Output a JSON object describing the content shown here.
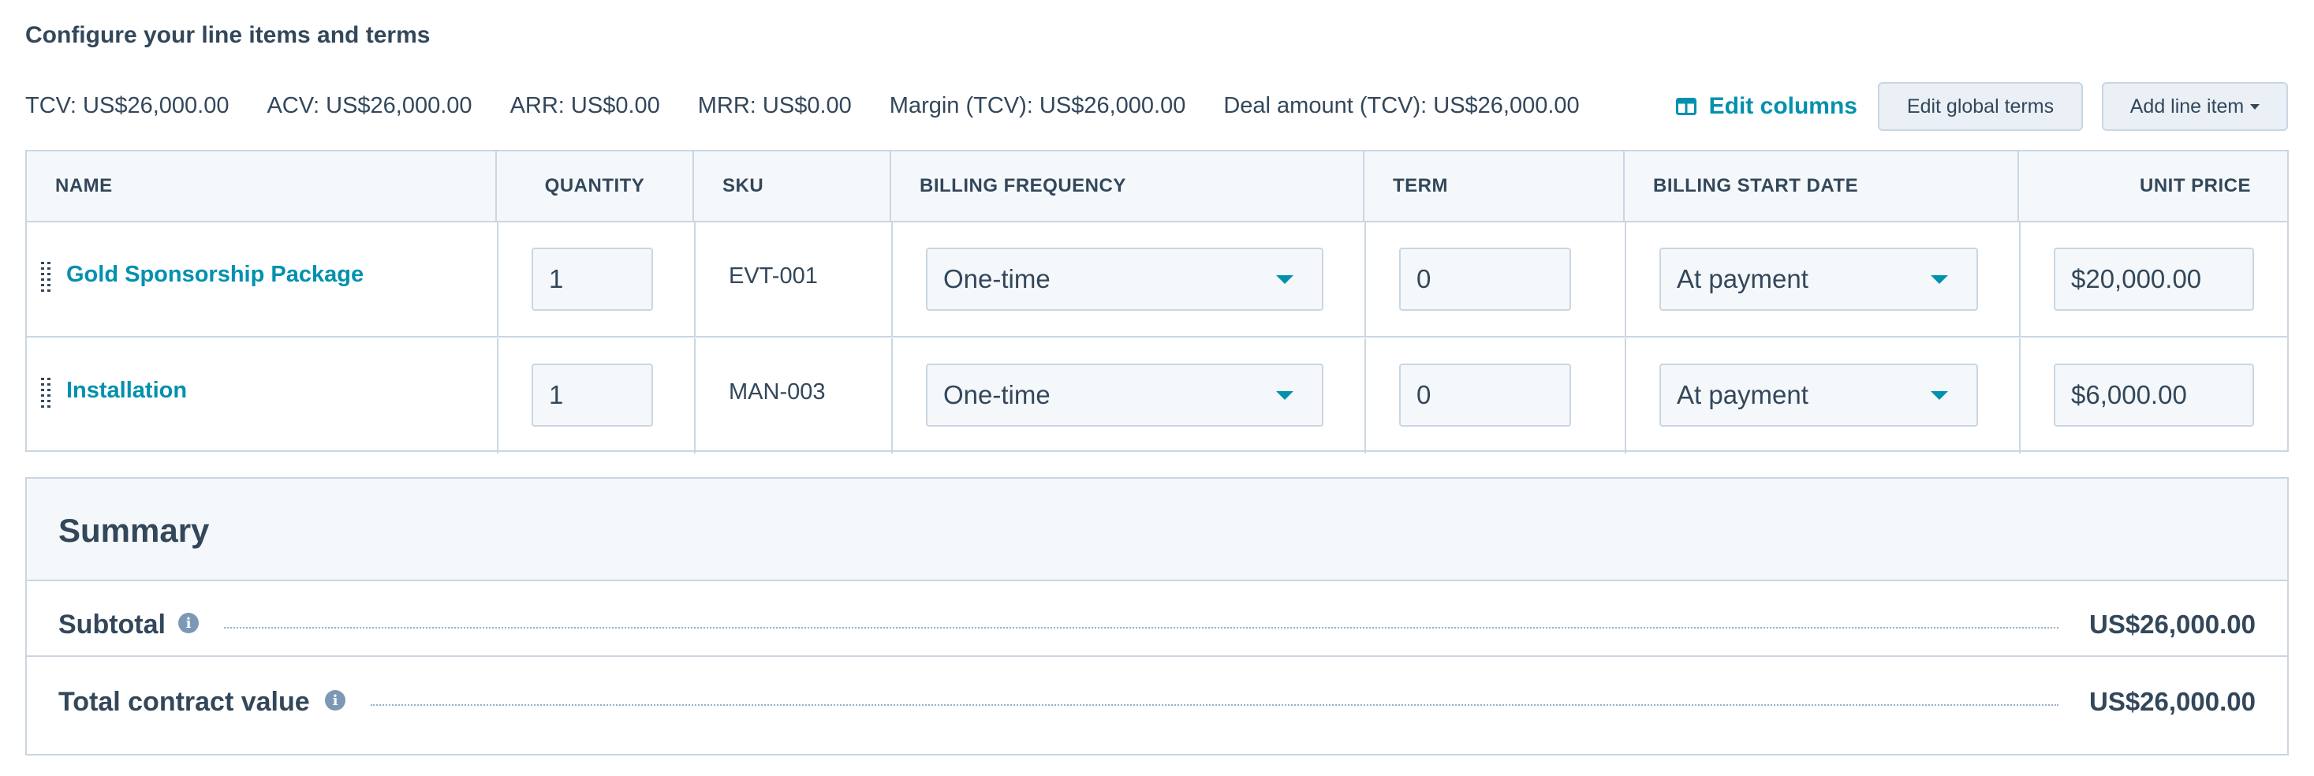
{
  "heading": "Configure your line items and terms",
  "metrics": [
    "TCV: US$26,000.00",
    "ACV: US$26,000.00",
    "ARR: US$0.00",
    "MRR: US$0.00",
    "Margin (TCV): US$26,000.00",
    "Deal amount (TCV): US$26,000.00"
  ],
  "toolbar": {
    "edit_columns": "Edit columns",
    "edit_global_terms": "Edit global terms",
    "add_line_item": "Add line item"
  },
  "columns": {
    "name": "NAME",
    "quantity": "QUANTITY",
    "sku": "SKU",
    "billing_frequency": "BILLING FREQUENCY",
    "term": "TERM",
    "billing_start_date": "BILLING START DATE",
    "unit_price": "UNIT PRICE"
  },
  "line_items": [
    {
      "name": "Gold Sponsorship Package",
      "quantity": "1",
      "sku": "EVT-001",
      "billing_frequency": "One-time",
      "term": "0",
      "billing_start_date": "At payment",
      "unit_price": "$20,000.00"
    },
    {
      "name": "Installation",
      "quantity": "1",
      "sku": "MAN-003",
      "billing_frequency": "One-time",
      "term": "0",
      "billing_start_date": "At payment",
      "unit_price": "$6,000.00"
    }
  ],
  "summary": {
    "title": "Summary",
    "subtotal_label": "Subtotal",
    "subtotal_value": "US$26,000.00",
    "tcv_label": "Total contract value",
    "tcv_value": "US$26,000.00"
  },
  "colors": {
    "link": "#0091ae",
    "text": "#33475b",
    "border": "#cbd6e2",
    "header_bg": "#f5f8fa"
  }
}
